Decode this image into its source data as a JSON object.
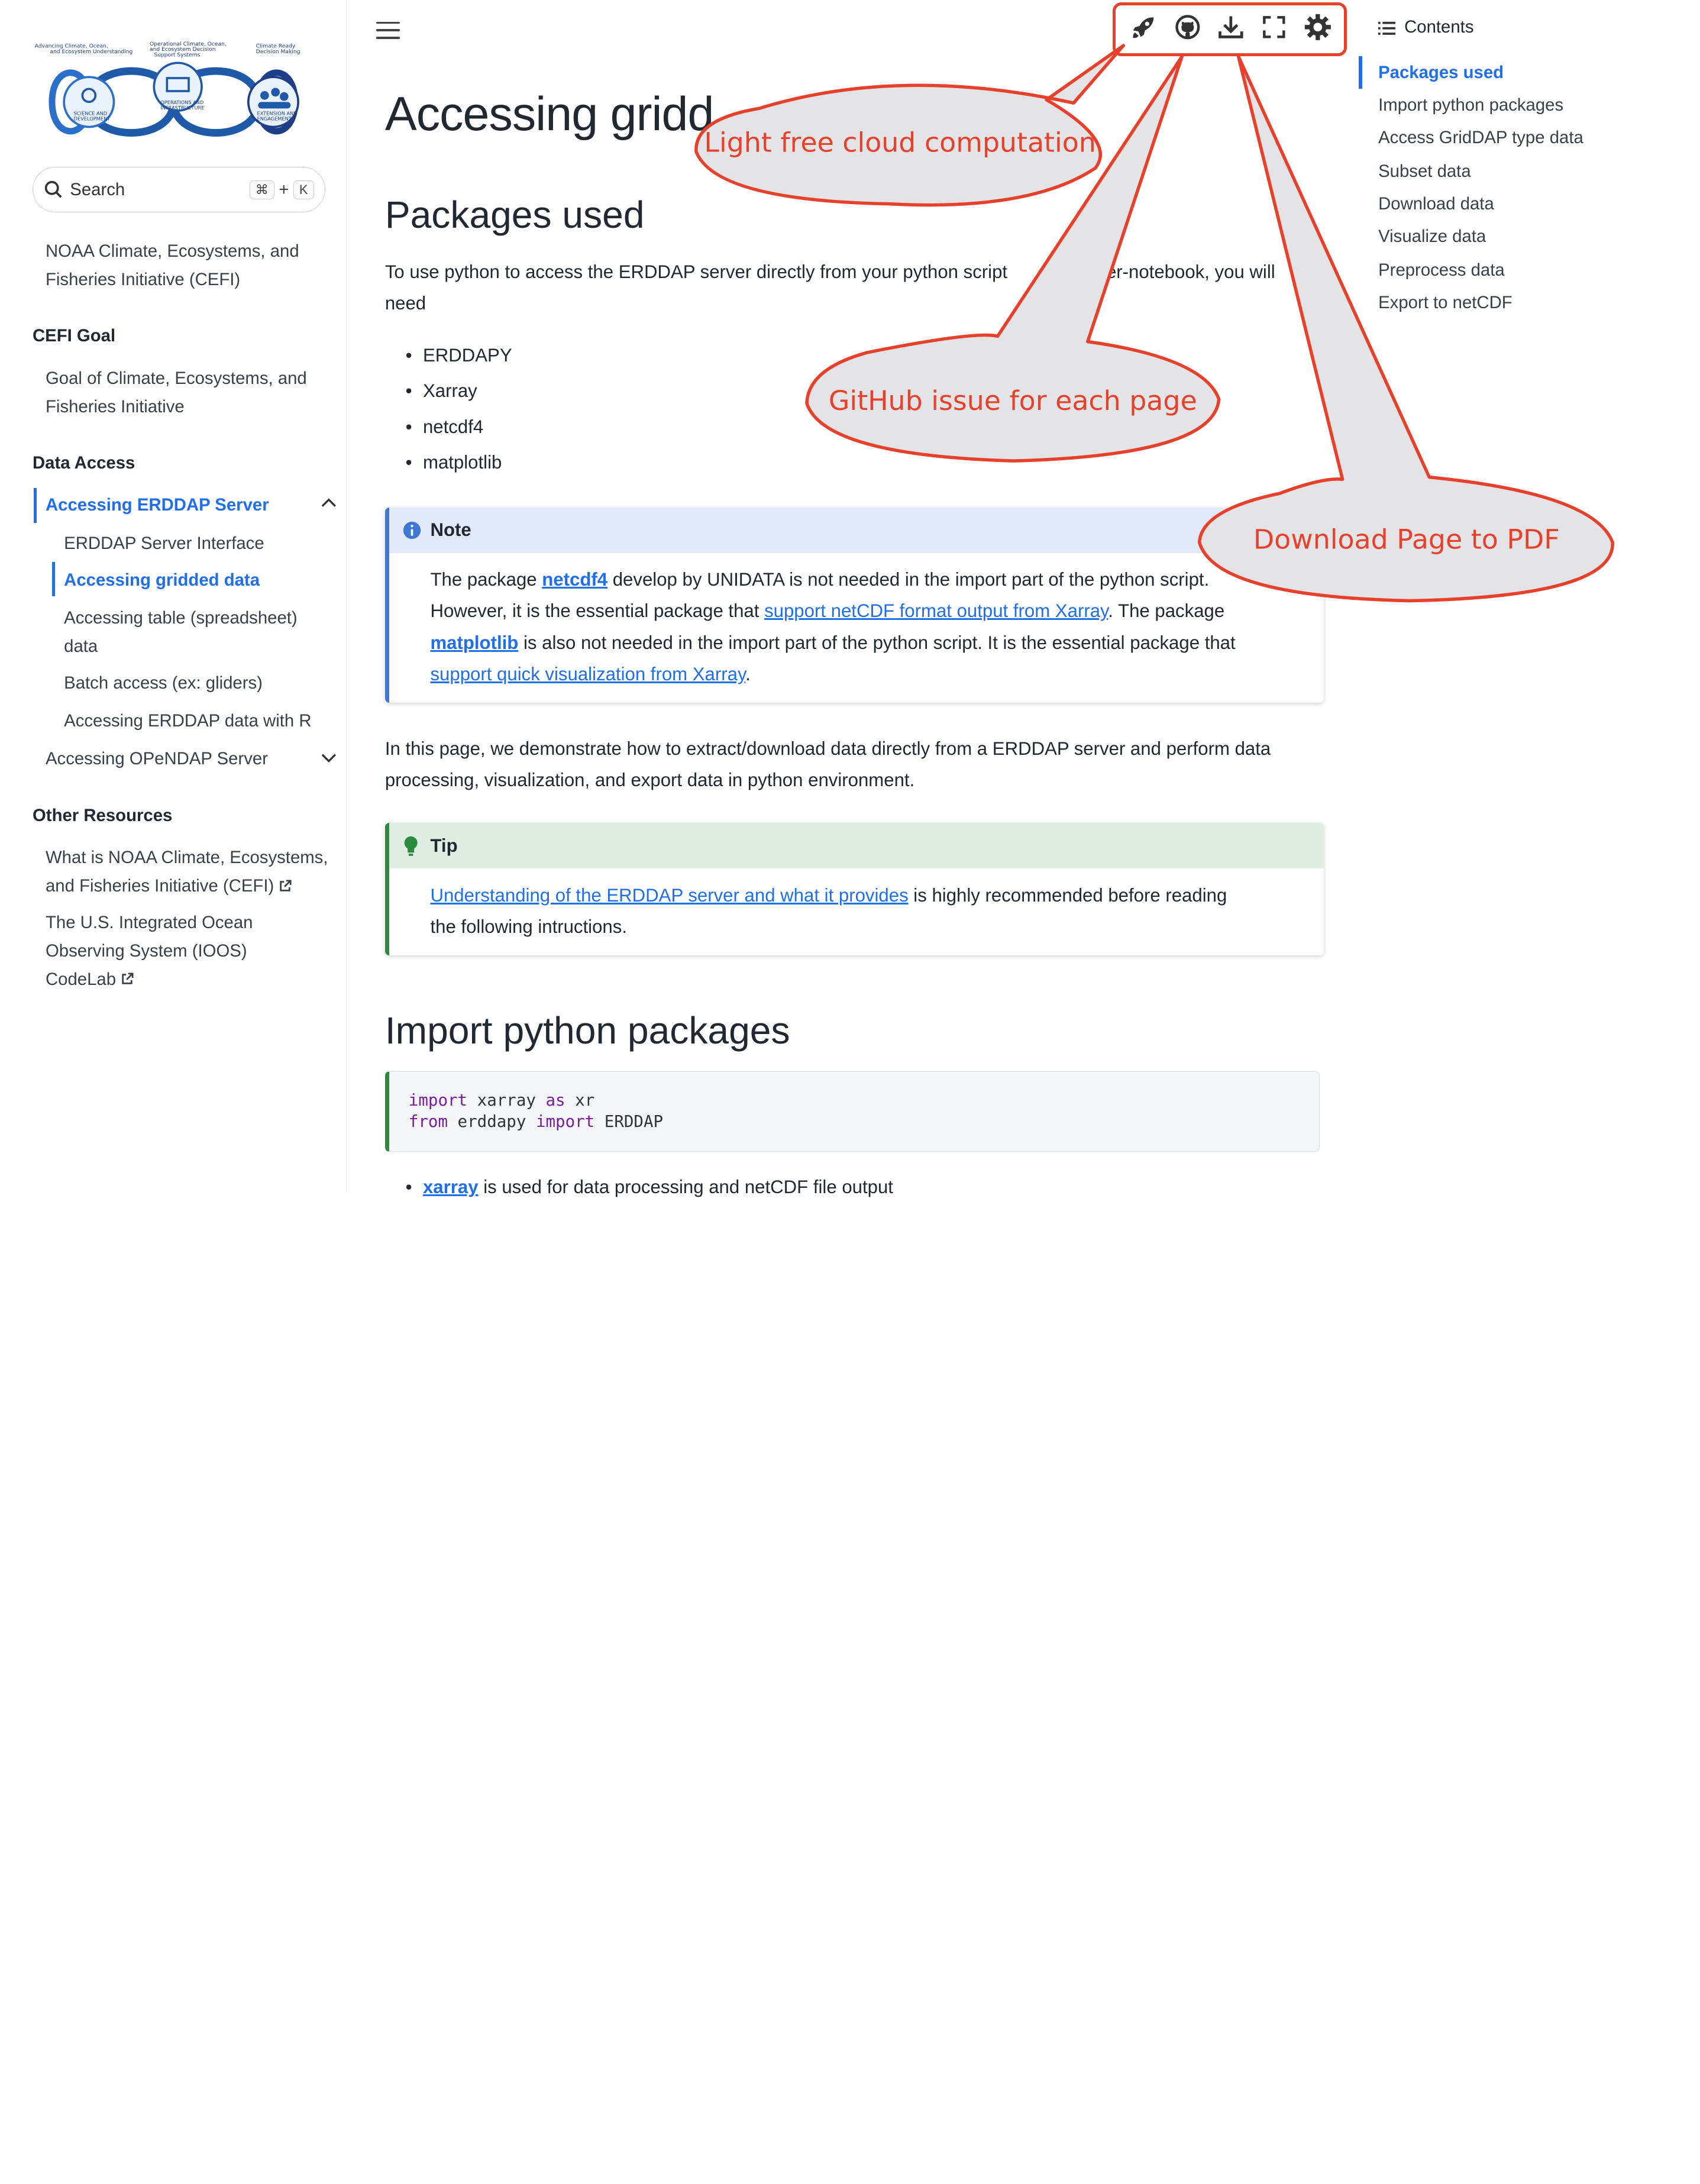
{
  "sidebar": {
    "search": {
      "label": "Search",
      "key1": "⌘",
      "plus": "+",
      "key2": "K"
    },
    "top_link": [
      "NOAA Climate, Ecosystems, and",
      "Fisheries Initiative (CEFI)"
    ],
    "sections": [
      {
        "heading": "CEFI Goal",
        "items": [
          [
            "Goal of Climate, Ecosystems, and",
            "Fisheries Initiative"
          ]
        ]
      },
      {
        "heading": "Data Access"
      },
      {
        "heading": "Other Resources"
      }
    ],
    "data_access": {
      "group1": "Accessing ERDDAP Server",
      "group1_children": [
        "ERDDAP Server Interface",
        "Accessing gridded data",
        [
          "Accessing table (spreadsheet)",
          "data"
        ],
        "Batch access (ex: gliders)",
        "Accessing ERDDAP data with R"
      ],
      "group2": "Accessing OPeNDAP Server"
    },
    "other": [
      [
        "What is NOAA Climate, Ecosystems,",
        "and Fisheries Initiative (CEFI)"
      ],
      [
        "The U.S. Integrated Ocean",
        "Observing System (IOOS)",
        "CodeLab"
      ]
    ],
    "logo": {
      "labels": [
        "Advancing Climate, Ocean,",
        "and Ecosystem Understanding",
        "Operational Climate, Ocean,",
        "and Ecosystem Decision",
        "Support Systems",
        "Climate Ready",
        "Decision Making",
        "SCIENCE AND",
        "DEVELOPMENT",
        "OPERATIONS AND",
        "INFRASTRUCTURE",
        "EXTENSION AND",
        "ENGAGEMENT"
      ]
    }
  },
  "toolbar": {
    "icons": [
      "rocket-icon",
      "github-icon",
      "download-icon",
      "fullscreen-icon",
      "theme-gear-icon"
    ]
  },
  "main": {
    "title": "Accessing gridd",
    "s1_heading": "Packages used",
    "s1_para_a": "To use python to access the ERDDAP server directly from your python script",
    "s1_para_b": "er-notebook, you will",
    "s1_para_c": "need",
    "packages": [
      "ERDDAPY",
      "Xarray",
      "netcdf4",
      "matplotlib"
    ],
    "note": {
      "title": "Note",
      "t1": "The package ",
      "l1": "netcdf4",
      "t2": " develop by UNIDATA is not needed in the import part of the python script.",
      "t3": "However, it is the essential package that ",
      "l2": "support netCDF format output from Xarray",
      "t4": ". The package",
      "l3": "matplotlib",
      "t5": " is also not needed in the import part of the python script. It is the essential package that",
      "l4": "support quick visualization from Xarray",
      "t6": "."
    },
    "intro_a": "In this page, we demonstrate how to extract/download data directly from a ERDDAP server and perform data",
    "intro_b": "processing, visualization, and export data in python environment.",
    "tip": {
      "title": "Tip",
      "l1": "Understanding of the ERDDAP server and what it provides",
      "t1": " is highly recommended before reading",
      "t2": "the following intructions."
    },
    "s2_heading": "Import python packages",
    "code": {
      "l1_kw1": "import",
      "l1_mid": " xarray ",
      "l1_kw2": "as",
      "l1_end": " xr",
      "l2_kw1": "from",
      "l2_mid": " erddapy ",
      "l2_kw2": "import",
      "l2_end": " ERDDAP"
    },
    "bottom_link": "xarray",
    "bottom_text": " is used for data processing and netCDF file output"
  },
  "toc": {
    "heading": "Contents",
    "items": [
      "Packages used",
      "Import python packages",
      "Access GridDAP type data",
      "Subset data",
      "Download data",
      "Visualize data",
      "Preprocess data",
      "Export to netCDF"
    ]
  },
  "callouts": {
    "launch": "Light free cloud computation",
    "github": "GitHub issue for each page",
    "download": "Download Page to PDF"
  },
  "colors": {
    "accent": "#1f6feb",
    "callout": "#e8402a",
    "note_bg": "#e1e9fb",
    "tip_bg": "#dfeee3",
    "tip_border": "#2b8a3e"
  }
}
